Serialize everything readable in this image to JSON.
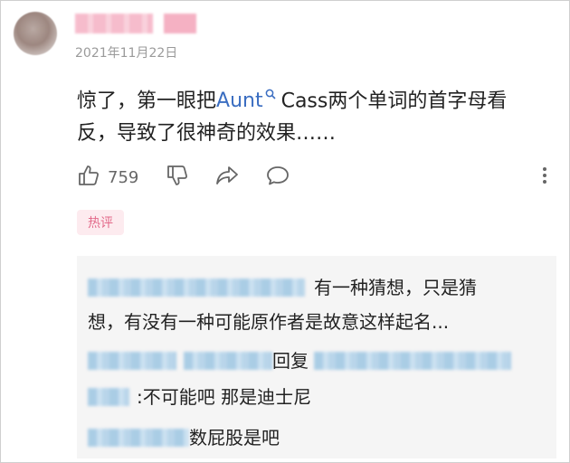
{
  "comment": {
    "date": "2021年11月22日",
    "text_before": "惊了，第一眼把",
    "highlight": "Aunt",
    "text_after_line1": "Cass两个单词的首字母看",
    "text_line2": "反，导致了很神奇的效果……",
    "like_count": "759"
  },
  "tag": {
    "label": "热评"
  },
  "replies": {
    "reply1_line1": "有一种猜想，只是猜",
    "reply1_line2": "想，有没有一种可能原作者是故意这样起名...",
    "reply2_mid": "回复",
    "reply3_text": ":不可能吧 那是迪士尼",
    "reply4_text": "数屁股是吧"
  },
  "colors": {
    "link": "#3a6dc1",
    "tag_bg": "#fdebef",
    "tag_text": "#e36a8a"
  },
  "icons": [
    "thumbs-up-icon",
    "thumbs-down-icon",
    "share-icon",
    "comment-icon",
    "more-vertical-icon",
    "search-icon"
  ]
}
